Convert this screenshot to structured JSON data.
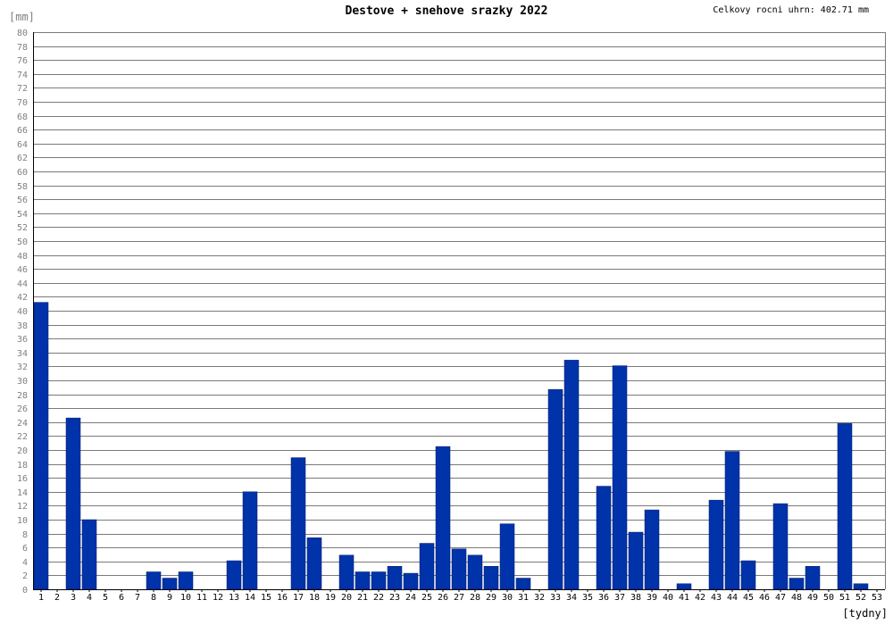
{
  "chart_data": {
    "type": "bar",
    "title": "Destove + snehove srazky 2022",
    "total_label": "Celkovy rocni uhrn: 402.71 mm",
    "ylabel": "[mm]",
    "xlabel": "[tydny]",
    "ylim": [
      0,
      80
    ],
    "ytick_step": 2,
    "grid": true,
    "bar_color": "#0033aa",
    "categories": [
      "1",
      "2",
      "3",
      "4",
      "5",
      "6",
      "7",
      "8",
      "9",
      "10",
      "11",
      "12",
      "13",
      "14",
      "15",
      "16",
      "17",
      "18",
      "19",
      "20",
      "21",
      "22",
      "23",
      "24",
      "25",
      "26",
      "27",
      "28",
      "29",
      "30",
      "31",
      "32",
      "33",
      "34",
      "35",
      "36",
      "37",
      "38",
      "39",
      "40",
      "41",
      "42",
      "43",
      "44",
      "45",
      "46",
      "47",
      "48",
      "49",
      "50",
      "51",
      "52",
      "53"
    ],
    "values": [
      41.2,
      0,
      24.6,
      10,
      0,
      0,
      0,
      2.5,
      1.6,
      2.5,
      0,
      0,
      4.1,
      14,
      0,
      0,
      18.9,
      7.4,
      0,
      4.9,
      2.5,
      2.5,
      3.3,
      2.3,
      6.6,
      20.5,
      5.8,
      4.9,
      3.3,
      9.4,
      1.6,
      0,
      28.7,
      32.9,
      0,
      14.8,
      32.1,
      8.2,
      11.4,
      0,
      0.8,
      0,
      12.8,
      19.8,
      4.1,
      0,
      12.3,
      1.6,
      3.3,
      0,
      23.8,
      0.8,
      0
    ]
  }
}
